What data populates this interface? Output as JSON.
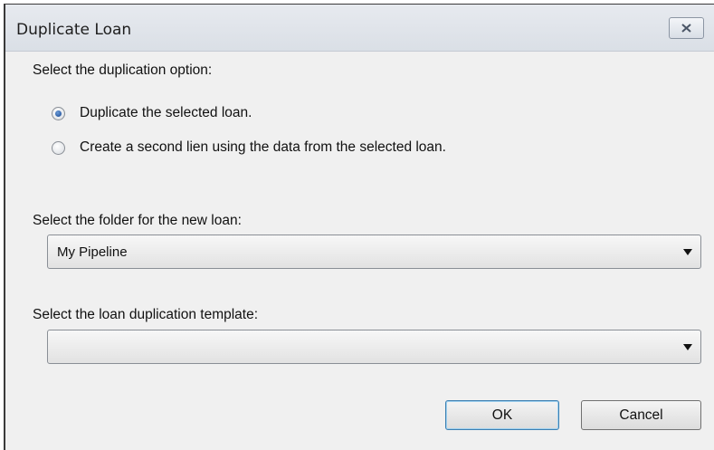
{
  "window": {
    "title": "Duplicate Loan",
    "close_icon": "close-icon"
  },
  "duplication": {
    "label": "Select the duplication option:",
    "options": [
      {
        "label": "Duplicate the selected loan.",
        "selected": true
      },
      {
        "label": "Create a second lien using the data from the selected loan.",
        "selected": false
      }
    ]
  },
  "folder": {
    "label": "Select the folder for the new loan:",
    "value": "My Pipeline"
  },
  "template": {
    "label": "Select the loan duplication template:",
    "value": ""
  },
  "buttons": {
    "ok": "OK",
    "cancel": "Cancel"
  },
  "colors": {
    "dialog_background": "#f0f0f0",
    "default_button_border": "#3c7fb1",
    "radio_selected": "#15458f"
  }
}
